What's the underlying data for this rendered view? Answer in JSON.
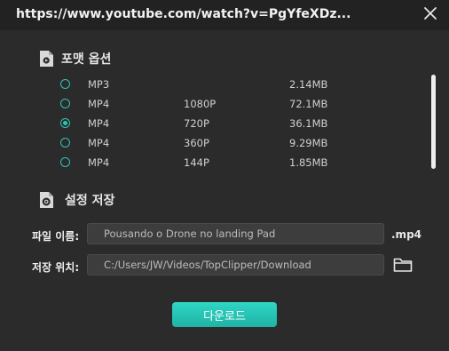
{
  "window": {
    "url": "https://www.youtube.com/watch?v=PgYfeXDz..."
  },
  "format_section": {
    "title": "포맷 옵션",
    "options": [
      {
        "format": "MP3",
        "resolution": "",
        "size": "2.14MB",
        "selected": false
      },
      {
        "format": "MP4",
        "resolution": "1080P",
        "size": "72.1MB",
        "selected": false
      },
      {
        "format": "MP4",
        "resolution": "720P",
        "size": "36.1MB",
        "selected": true
      },
      {
        "format": "MP4",
        "resolution": "360P",
        "size": "9.29MB",
        "selected": false
      },
      {
        "format": "MP4",
        "resolution": "144P",
        "size": "1.85MB",
        "selected": false
      }
    ]
  },
  "settings_section": {
    "title": "설정 저장",
    "filename_label": "파일 이름:",
    "filename_value": "Pousando o Drone no  landing Pad",
    "extension": ".mp4",
    "path_label": "저장 위치:",
    "path_value": "C:/Users/JW/Videos/TopClipper/Download"
  },
  "actions": {
    "download_label": "다운로드"
  },
  "colors": {
    "accent": "#2ec4b6",
    "background": "#2b2b2b",
    "titlebar": "#222222"
  }
}
